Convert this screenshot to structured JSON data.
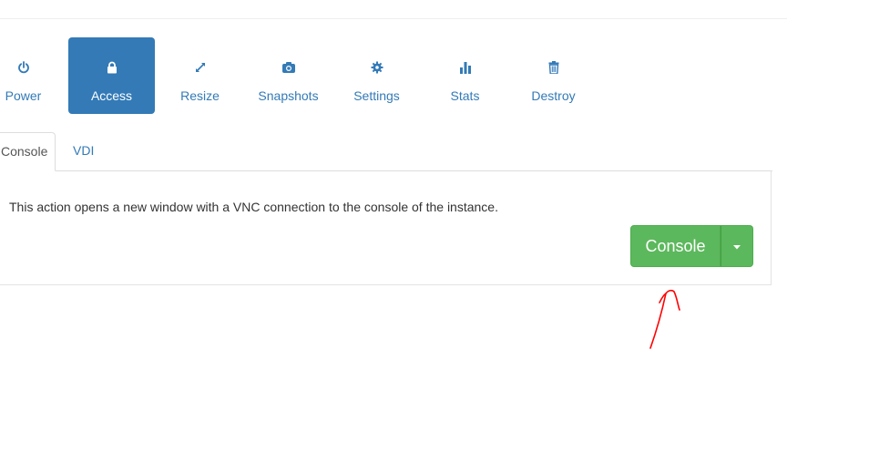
{
  "actions": [
    {
      "label": "Power",
      "icon": "power-icon"
    },
    {
      "label": "Access",
      "icon": "lock-icon",
      "active": true
    },
    {
      "label": "Resize",
      "icon": "resize-icon"
    },
    {
      "label": "Snapshots",
      "icon": "camera-icon"
    },
    {
      "label": "Settings",
      "icon": "gear-icon"
    },
    {
      "label": "Stats",
      "icon": "bar-chart-icon"
    },
    {
      "label": "Destroy",
      "icon": "trash-icon"
    }
  ],
  "tabs": [
    {
      "label": "Console",
      "active": true
    },
    {
      "label": "VDI"
    }
  ],
  "console_panel": {
    "description": "This action opens a new window with a VNC connection to the console of the instance.",
    "button_label": "Console",
    "caret_icon": "caret-down-icon"
  },
  "annotation": {
    "type": "red-arrow",
    "color": "#ff0000"
  },
  "colors": {
    "primary": "#337ab7",
    "success": "#5cb85c",
    "text": "#333333"
  }
}
